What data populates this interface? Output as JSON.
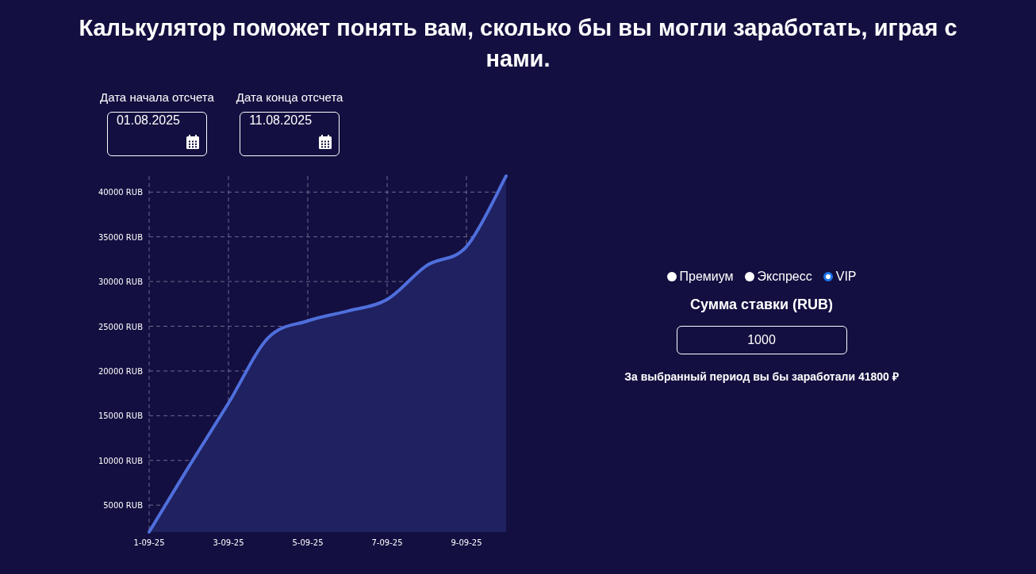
{
  "title": "Калькулятор поможет понять вам, сколько бы вы могли заработать, играя с нами.",
  "date_fields": [
    {
      "label": "Дата начала отсчета",
      "value": "01.08.2025"
    },
    {
      "label": "Дата конца отсчета",
      "value": "11.08.2025"
    }
  ],
  "chart": {
    "chart_data": {
      "type": "area",
      "categories": [
        "1-09-25",
        null,
        "3-09-25",
        null,
        "5-09-25",
        null,
        "7-09-25",
        null,
        "9-09-25",
        null
      ],
      "series": [
        {
          "color": "#4f6fdc",
          "values": [
            2000,
            9300,
            16400,
            23700,
            25600,
            26700,
            28000,
            31800,
            33900,
            41800
          ]
        }
      ],
      "ylim": [
        2000,
        41800
      ],
      "grid": true,
      "yticks": [
        {
          "value": 5000,
          "label": "5000 RUB"
        },
        {
          "value": 10000,
          "label": "10000 RUB"
        },
        {
          "value": 15000,
          "label": "15000 RUB"
        },
        {
          "value": 20000,
          "label": "20000 RUB"
        },
        {
          "value": 25000,
          "label": "25000 RUB"
        },
        {
          "value": 30000,
          "label": "30000 RUB"
        },
        {
          "value": 35000,
          "label": "35000 RUB"
        },
        {
          "value": 40000,
          "label": "40000 RUB"
        }
      ]
    }
  },
  "options": [
    {
      "label": "Премиум",
      "selected": false
    },
    {
      "label": "Экспресс",
      "selected": false
    },
    {
      "label": "VIP",
      "selected": true
    }
  ],
  "stake": {
    "label": "Сумма ставки (RUB)",
    "value": "1000"
  },
  "result": "За выбранный период вы бы заработали 41800 ₽"
}
